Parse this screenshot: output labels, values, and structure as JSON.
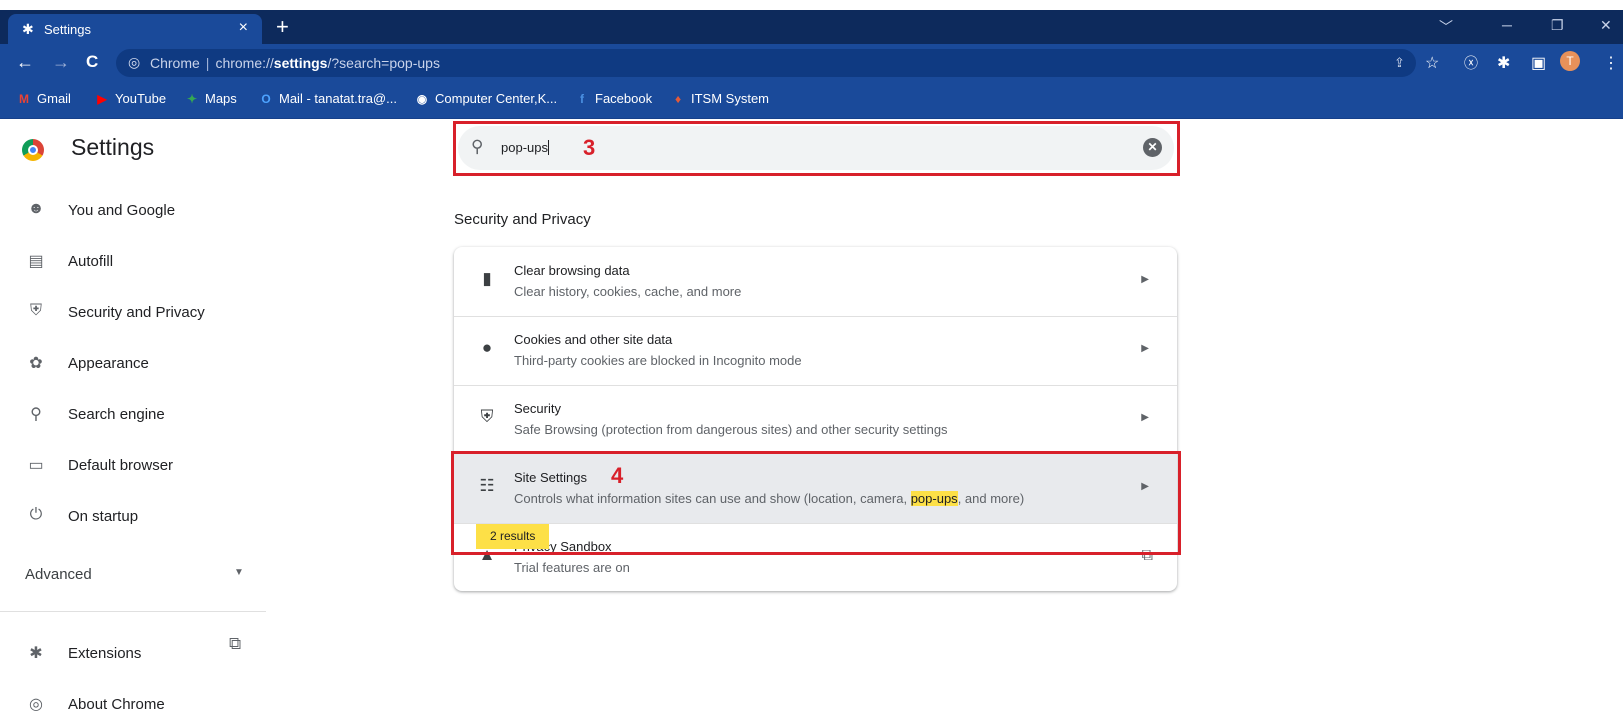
{
  "tab": {
    "title": "Settings",
    "close": "×",
    "new_tab": "+"
  },
  "window_controls": {
    "dropdown": "﹀",
    "minimize": "─",
    "restore": "❐",
    "close": "✕"
  },
  "toolbar": {
    "back": "←",
    "forward": "→",
    "reload": "C",
    "site_label": "Chrome",
    "url_scheme": "chrome://",
    "url_host": "settings",
    "url_path": "/?search=pop-ups",
    "icons": [
      "share-icon",
      "star-icon",
      "extension-x-icon",
      "puzzle-icon",
      "sidepanel-icon",
      "menu-icon"
    ],
    "avatar_initial": "T"
  },
  "bookmarks": [
    {
      "label": "Gmail",
      "icon": "gmail-icon",
      "glyph": "M",
      "color": "#ea4335"
    },
    {
      "label": "YouTube",
      "icon": "youtube-icon",
      "glyph": "▶",
      "color": "#ff0000"
    },
    {
      "label": "Maps",
      "icon": "maps-icon",
      "glyph": "✦",
      "color": "#34a853"
    },
    {
      "label": "Mail - tanatat.tra@...",
      "icon": "outlook-icon",
      "glyph": "O",
      "color": "#4da3ff"
    },
    {
      "label": "Computer Center,K...",
      "icon": "globe-icon",
      "glyph": "◉",
      "color": "#ffffff"
    },
    {
      "label": "Facebook",
      "icon": "facebook-icon",
      "glyph": "f",
      "color": "#4a90e2"
    },
    {
      "label": "ITSM System",
      "icon": "itsm-icon",
      "glyph": "♦",
      "color": "#e25a3a"
    }
  ],
  "sidebar": {
    "title": "Settings",
    "items": [
      {
        "label": "You and Google",
        "icon": "person-icon",
        "glyph": "👤"
      },
      {
        "label": "Autofill",
        "icon": "clipboard-icon",
        "glyph": "📋"
      },
      {
        "label": "Security and Privacy",
        "icon": "shield-icon",
        "glyph": "⛨"
      },
      {
        "label": "Appearance",
        "icon": "palette-icon",
        "glyph": "🎨"
      },
      {
        "label": "Search engine",
        "icon": "search-icon",
        "glyph": "🔍"
      },
      {
        "label": "Default browser",
        "icon": "browser-window-icon",
        "glyph": "▭"
      },
      {
        "label": "On startup",
        "icon": "power-icon",
        "glyph": "⏻"
      }
    ],
    "advanced": "Advanced",
    "bottom_items": [
      {
        "label": "Extensions",
        "icon": "puzzle-icon",
        "glyph": "✱"
      },
      {
        "label": "About Chrome",
        "icon": "chrome-icon",
        "glyph": "◎"
      }
    ]
  },
  "search": {
    "value": "pop-ups",
    "clear": "✕"
  },
  "annotations": {
    "label_3": "3",
    "label_4": "4"
  },
  "section_heading": "Security and Privacy",
  "rows": [
    {
      "title": "Clear browsing data",
      "subtitle": "Clear history, cookies, cache, and more",
      "icon": "trash-icon",
      "glyph": "🗑"
    },
    {
      "title": "Cookies and other site data",
      "subtitle": "Third-party cookies are blocked in Incognito mode",
      "icon": "cookie-icon",
      "glyph": "🍪"
    },
    {
      "title": "Security",
      "subtitle": "Safe Browsing (protection from dangerous sites) and other security settings",
      "icon": "shield-icon",
      "glyph": "⛨"
    },
    {
      "title": "Site Settings",
      "subtitle_before": "Controls what information sites can use and show (location, camera, ",
      "subtitle_highlight": "pop-ups",
      "subtitle_after": ", and more)",
      "icon": "tune-icon",
      "glyph": "⚟"
    },
    {
      "title": "Privacy Sandbox",
      "subtitle": "Trial features are on",
      "icon": "flask-icon",
      "glyph": "▲"
    }
  ],
  "results_bubble": "2 results",
  "colors": {
    "accent_red": "#d8202a",
    "highlight": "#fde047",
    "chrome_blue": "#1a4a9a"
  }
}
